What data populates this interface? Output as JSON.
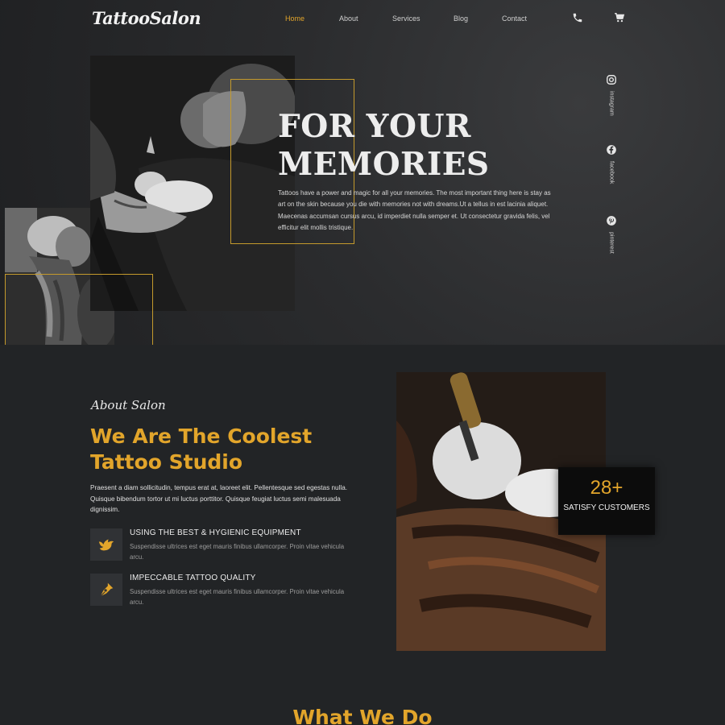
{
  "header": {
    "logo": "TattooSalon",
    "nav": [
      {
        "label": "Home",
        "active": true
      },
      {
        "label": "About",
        "active": false
      },
      {
        "label": "Services",
        "active": false
      },
      {
        "label": "Blog",
        "active": false
      },
      {
        "label": "Contact",
        "active": false
      }
    ],
    "icons": [
      "phone-icon",
      "cart-icon"
    ]
  },
  "hero": {
    "title_line1": "FOR YOUR",
    "title_line2": "MEMORIES",
    "text": "Tattoos have a power and magic for all your memories. The most important thing here is stay as art on the skin because you die with memories not with dreams.Ut a tellus in est lacinia aliquet. Maecenas accumsan cursus arcu, id imperdiet nulla semper et. Ut consectetur gravida felis, vel efficitur elit mollis tristique.",
    "social": [
      {
        "label": "instagram",
        "icon": "instagram-icon"
      },
      {
        "label": "facebook",
        "icon": "facebook-icon"
      },
      {
        "label": "pinterest",
        "icon": "pinterest-icon"
      }
    ]
  },
  "about": {
    "eyebrow": "About Salon",
    "title": "We Are The Coolest Tattoo Studio",
    "text": "Praesent a diam sollicitudin, tempus erat at, laoreet elit. Pellentesque sed egestas nulla. Quisque bibendum tortor ut mi luctus porttitor. Quisque feugiat luctus semi malesuada dignissim.",
    "features": [
      {
        "title": "USING THE BEST & HYGIENIC EQUIPMENT",
        "text": "Suspendisse ultrices est eget mauris finibus ullamcorper. Proin vitae vehicula arcu.",
        "icon": "bird-icon"
      },
      {
        "title": "IMPECCABLE TATTOO QUALITY",
        "text": "Suspendisse ultrices est eget mauris finibus ullamcorper. Proin vitae vehicula arcu.",
        "icon": "pen-nib-icon"
      }
    ],
    "stat": {
      "number": "28+",
      "label": "SATISFY CUSTOMERS"
    }
  },
  "next_section": {
    "title": "What We Do"
  },
  "colors": {
    "accent": "#e2a52b",
    "background": "#222426",
    "frame": "#c49a2c"
  }
}
